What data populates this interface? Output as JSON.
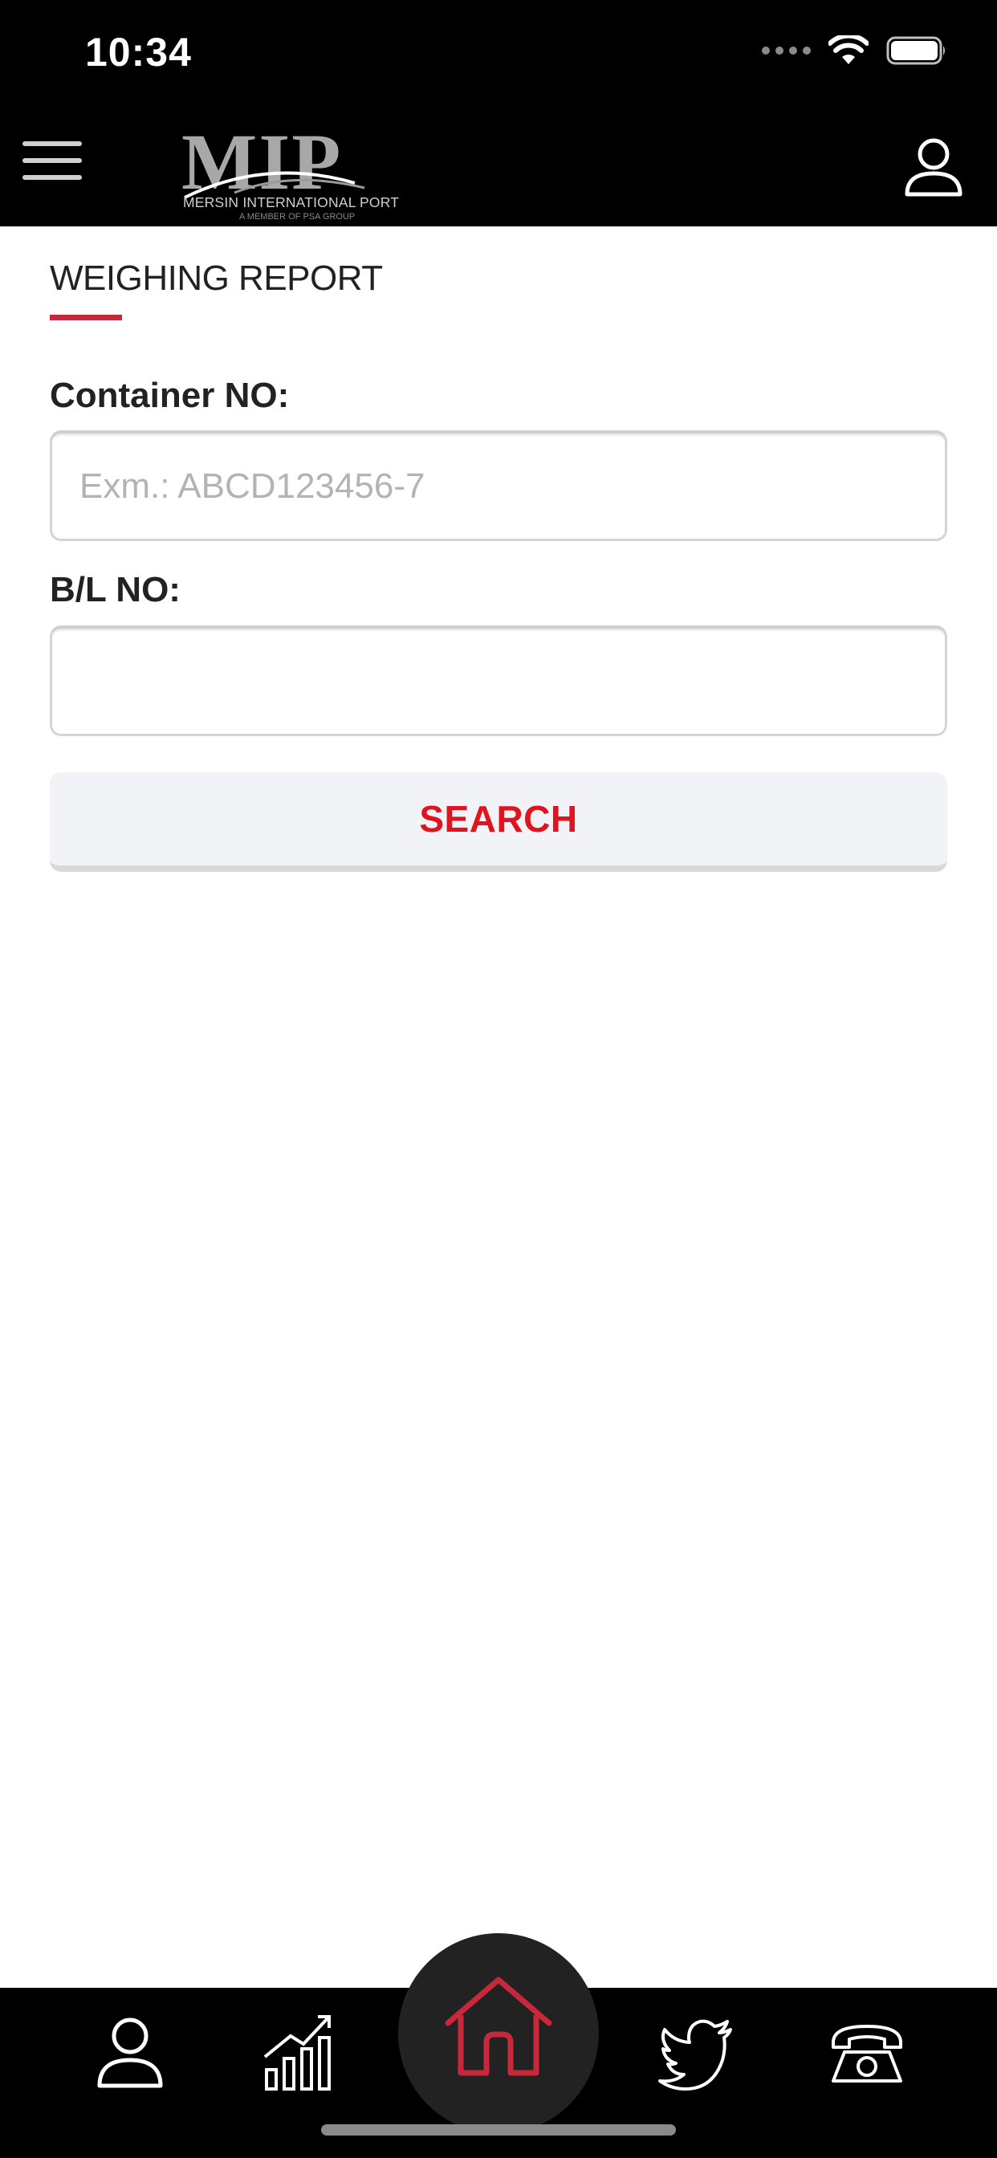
{
  "status_bar": {
    "time": "10:34",
    "icons": [
      "signal-dots-icon",
      "wifi-icon",
      "battery-icon"
    ]
  },
  "header": {
    "menu_icon": "hamburger-menu-icon",
    "logo": {
      "letters": "MIP",
      "subtitle": "MERSIN INTERNATIONAL PORT",
      "member_line": "A MEMBER OF PSA GROUP"
    },
    "account_icon": "user-icon"
  },
  "page": {
    "title": "WEIGHING REPORT",
    "accent_color": "#c8283a"
  },
  "form": {
    "container_label": "Container NO:",
    "container_value": "",
    "container_placeholder": "Exm.: ABCD123456-7",
    "bl_label": "B/L NO:",
    "bl_value": "",
    "bl_placeholder": "",
    "search_label": "SEARCH",
    "search_color": "#e0141e"
  },
  "tab_bar": {
    "items": [
      {
        "name": "profile",
        "icon": "user-icon"
      },
      {
        "name": "statistics",
        "icon": "chart-growth-icon"
      },
      {
        "name": "home",
        "icon": "home-icon",
        "active": true,
        "color": "#c8283a"
      },
      {
        "name": "twitter",
        "icon": "twitter-bird-icon"
      },
      {
        "name": "contact",
        "icon": "telephone-icon"
      }
    ]
  }
}
